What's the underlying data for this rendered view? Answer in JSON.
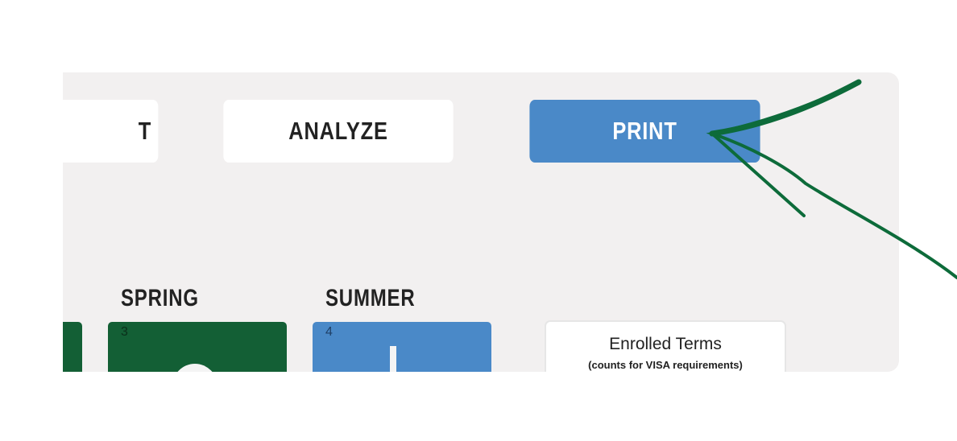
{
  "toolbar": {
    "partial_label": "T",
    "analyze_label": "ANALYZE",
    "print_label": "PRINT"
  },
  "terms": {
    "spring": {
      "label": "SPRING",
      "number": "3"
    },
    "summer": {
      "label": "SUMMER",
      "number": "4"
    }
  },
  "enrolled": {
    "title": "Enrolled Terms",
    "subtitle": "(counts for VISA requirements)"
  },
  "colors": {
    "accent_blue": "#4a89c8",
    "term_green": "#135f35",
    "arrow_green": "#0d6b3a",
    "panel_bg": "#f2f0f0"
  }
}
